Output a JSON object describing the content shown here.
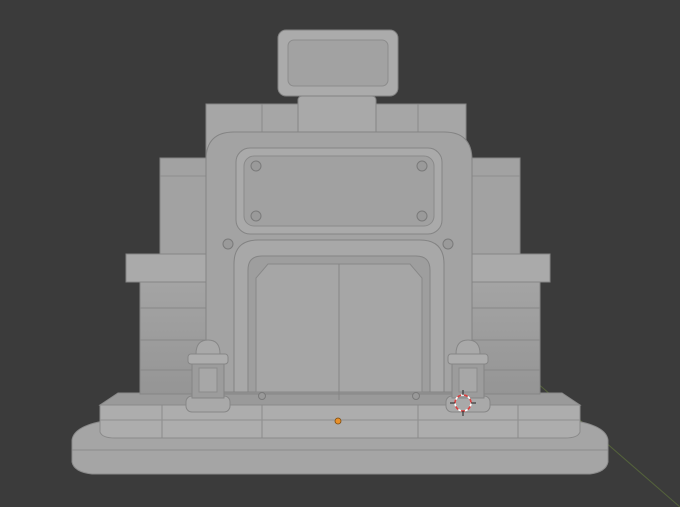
{
  "viewport": {
    "background": "#3b3b3b",
    "model_color": "#9c9c9c",
    "model_shade_dark": "#7e7e7e",
    "model_shade_light": "#b3b3b3",
    "origin_dot_color": "#e8902a",
    "cursor_color": "#d94040",
    "axis_line_color": "#6d8a3c"
  },
  "objects": {
    "icons": [
      "origin-point-icon",
      "3d-cursor-icon"
    ]
  }
}
